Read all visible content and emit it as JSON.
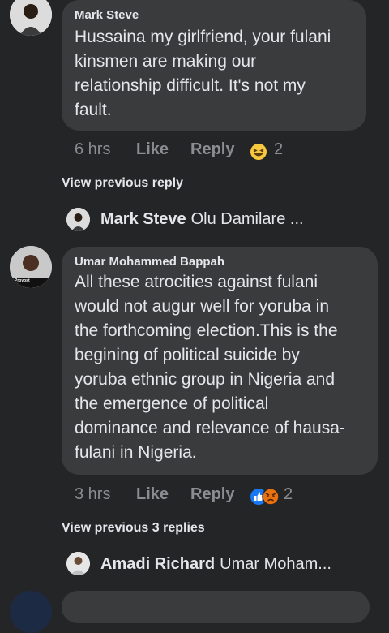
{
  "comments": [
    {
      "author": "Mark Steve",
      "text": "Hussaina my girlfriend, your fulani\nkinsmen are making our\nrelationship difficult. It's not my\nfault.",
      "time": "6 hrs",
      "like_label": "Like",
      "reply_label": "Reply",
      "reaction_count": "2",
      "reaction_icons": [
        "laughing-emoji"
      ],
      "view_previous": "View previous reply",
      "reply_preview": {
        "author": "Mark Steve",
        "text": "Olu Damilare ..."
      }
    },
    {
      "author": "Umar Mohammed Bappah",
      "avatar_caption": "Provost",
      "text": "All these atrocities against fulani\nwould not augur well for yoruba in\nthe forthcoming election.This is the\nbegining of political suicide by\nyoruba ethnic group in Nigeria and\nthe emergence of political\ndominance and relevance of hausa-\nfulani in Nigeria.",
      "time": "3 hrs",
      "like_label": "Like",
      "reply_label": "Reply",
      "reaction_count": "2",
      "reaction_icons": [
        "like-reaction",
        "angry-emoji"
      ],
      "view_previous": "View previous 3 replies",
      "reply_preview": {
        "author": "Amadi Richard",
        "text": "Umar Moham..."
      }
    }
  ],
  "colors": {
    "background": "#242526",
    "bubble": "#3a3b3c",
    "muted": "#8a8d91",
    "like_blue": "#1877f2"
  }
}
